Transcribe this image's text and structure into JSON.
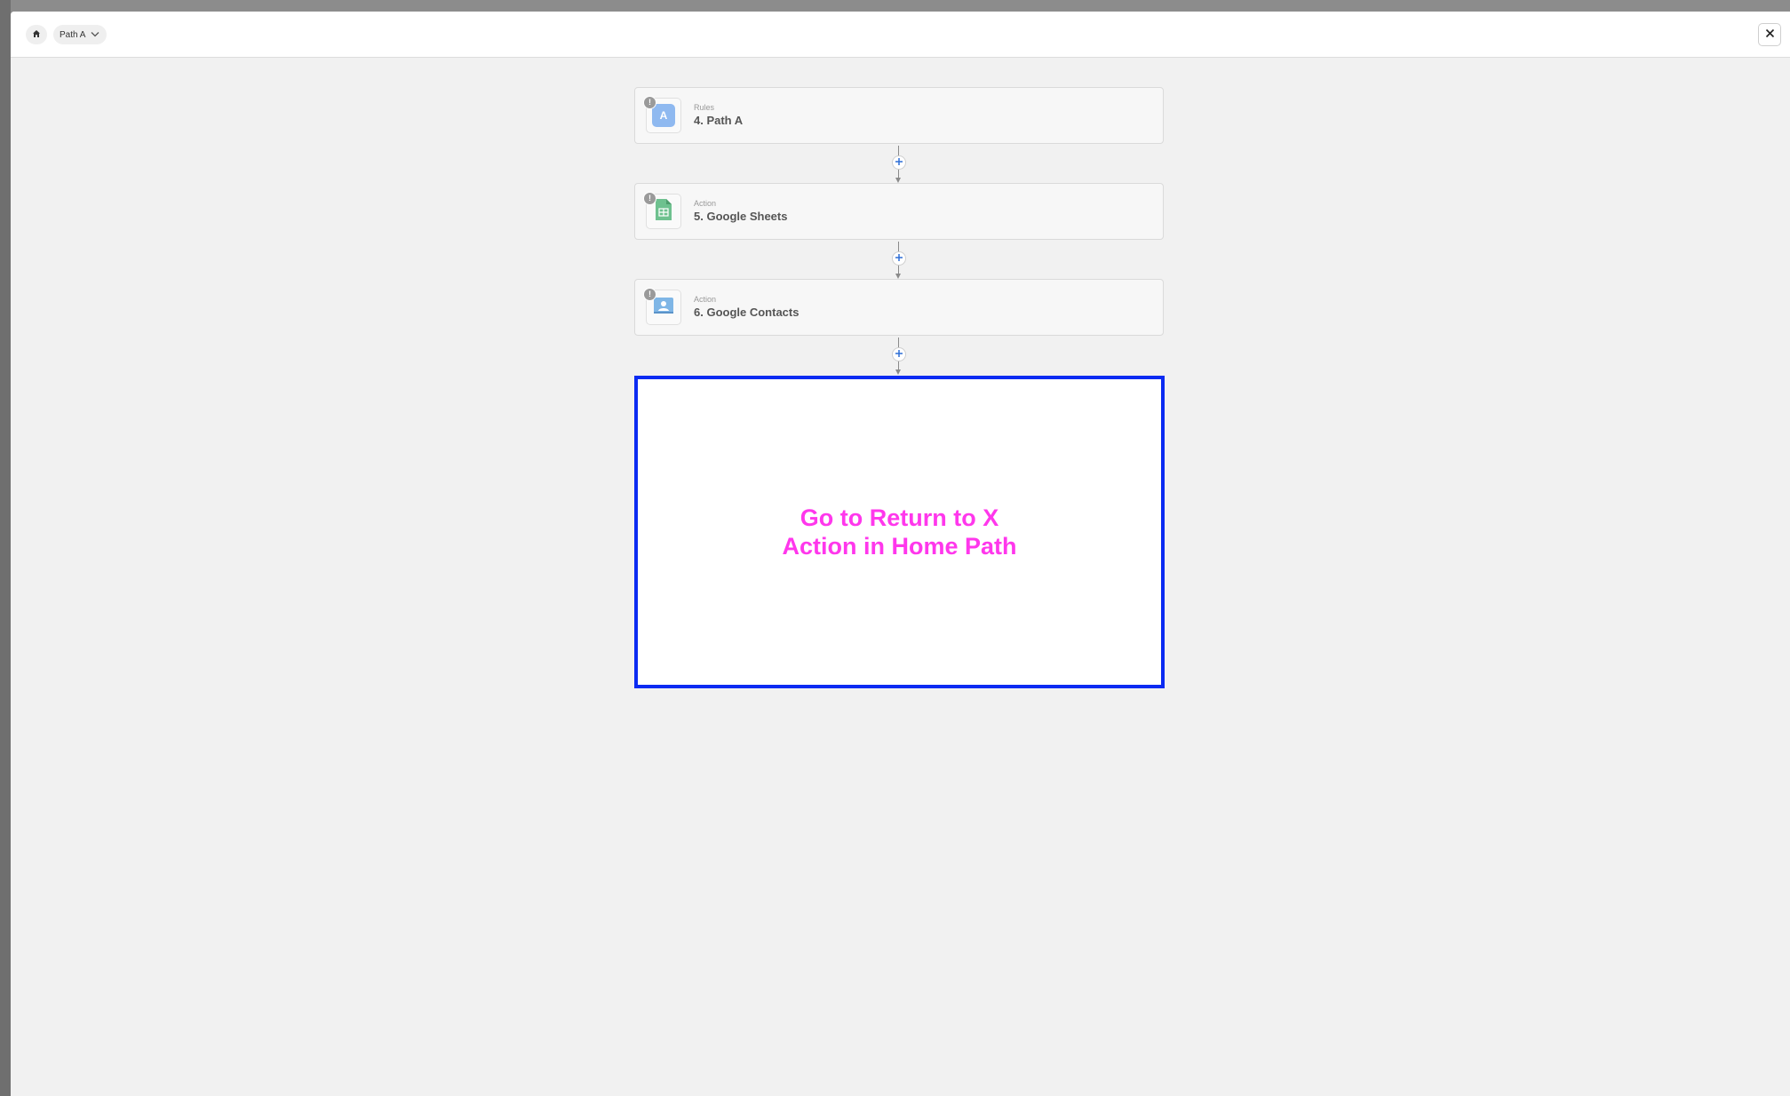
{
  "header": {
    "home_icon": "home-icon",
    "path_label": "Path A",
    "path_dropdown_icon": "chevron-down-icon",
    "close_icon": "close-icon"
  },
  "steps": [
    {
      "type": "Rules",
      "title": "4. Path A",
      "icon": "path-a-icon",
      "icon_letter": "A",
      "icon_color": "#8fb9f0"
    },
    {
      "type": "Action",
      "title": "5. Google Sheets",
      "icon": "google-sheets-icon",
      "icon_color": "#6ec18f"
    },
    {
      "type": "Action",
      "title": "6. Google Contacts",
      "icon": "google-contacts-icon",
      "icon_color": "#7fb6e6"
    }
  ],
  "warning_glyph": "!",
  "add_step_glyph": "+",
  "highlight": {
    "line1": "Go to Return to X",
    "line2": "Action in Home Path",
    "text_color": "#ff37ec",
    "border_color": "#0b2bf2"
  }
}
